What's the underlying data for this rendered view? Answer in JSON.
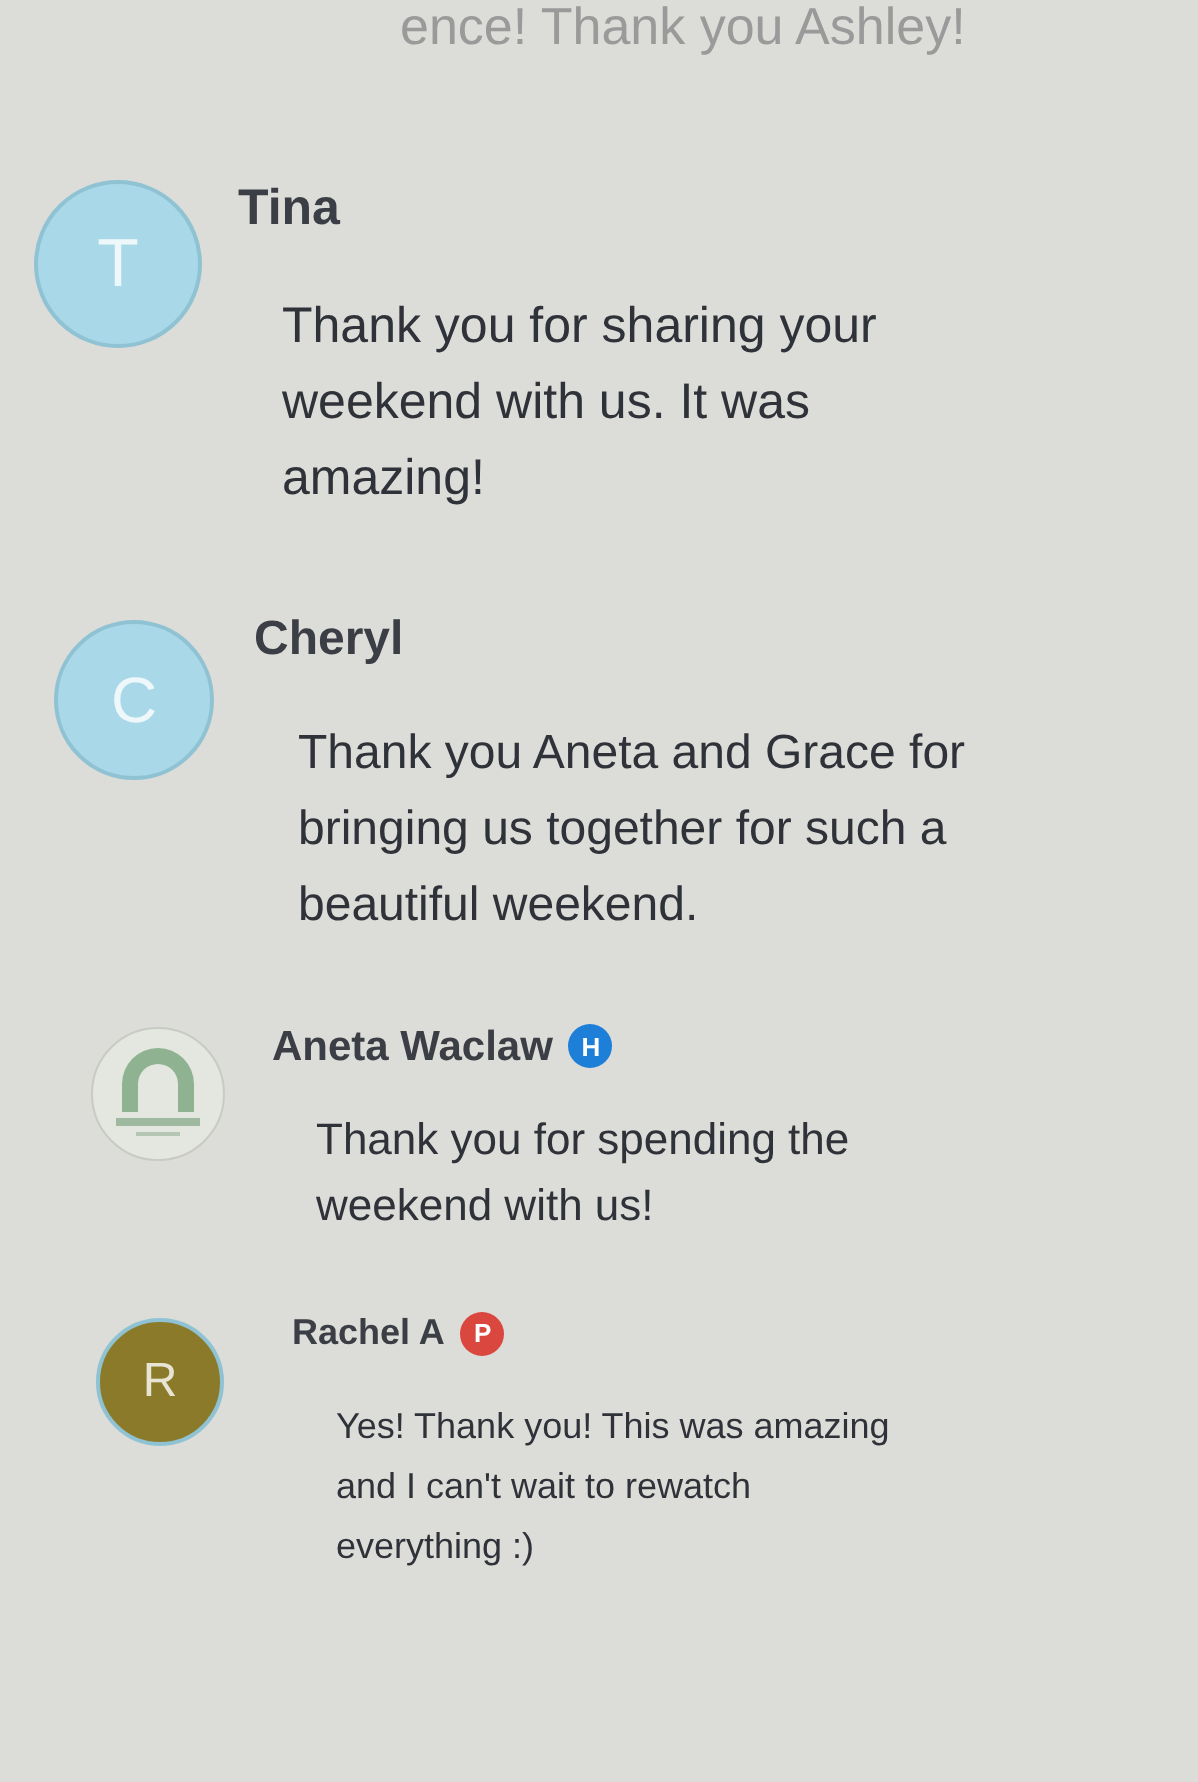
{
  "previous_comment_tail": "ence! Thank you Ashley!",
  "comments": [
    {
      "author": "Tina",
      "avatar": {
        "kind": "letter",
        "letter": "T",
        "color": "#a9d8e8"
      },
      "text": "Thank you for sharing your weekend with us.  It was amazing!"
    },
    {
      "author": "Cheryl",
      "avatar": {
        "kind": "letter",
        "letter": "C",
        "color": "#a9d8e8"
      },
      "text": "Thank you Aneta and Grace for bringing us together for such a beautiful weekend."
    },
    {
      "author": "Aneta Waclaw",
      "badge": {
        "letter": "H",
        "color": "#1e7fd8"
      },
      "avatar": {
        "kind": "logo"
      },
      "text": "Thank you for spending the weekend with us!"
    },
    {
      "author": "Rachel A",
      "badge": {
        "letter": "P",
        "color": "#d9473e"
      },
      "avatar": {
        "kind": "letter",
        "letter": "R",
        "color": "#8a7a2a"
      },
      "text": "Yes! Thank you! This was amazing and I can't wait to rewatch everything :)"
    }
  ]
}
